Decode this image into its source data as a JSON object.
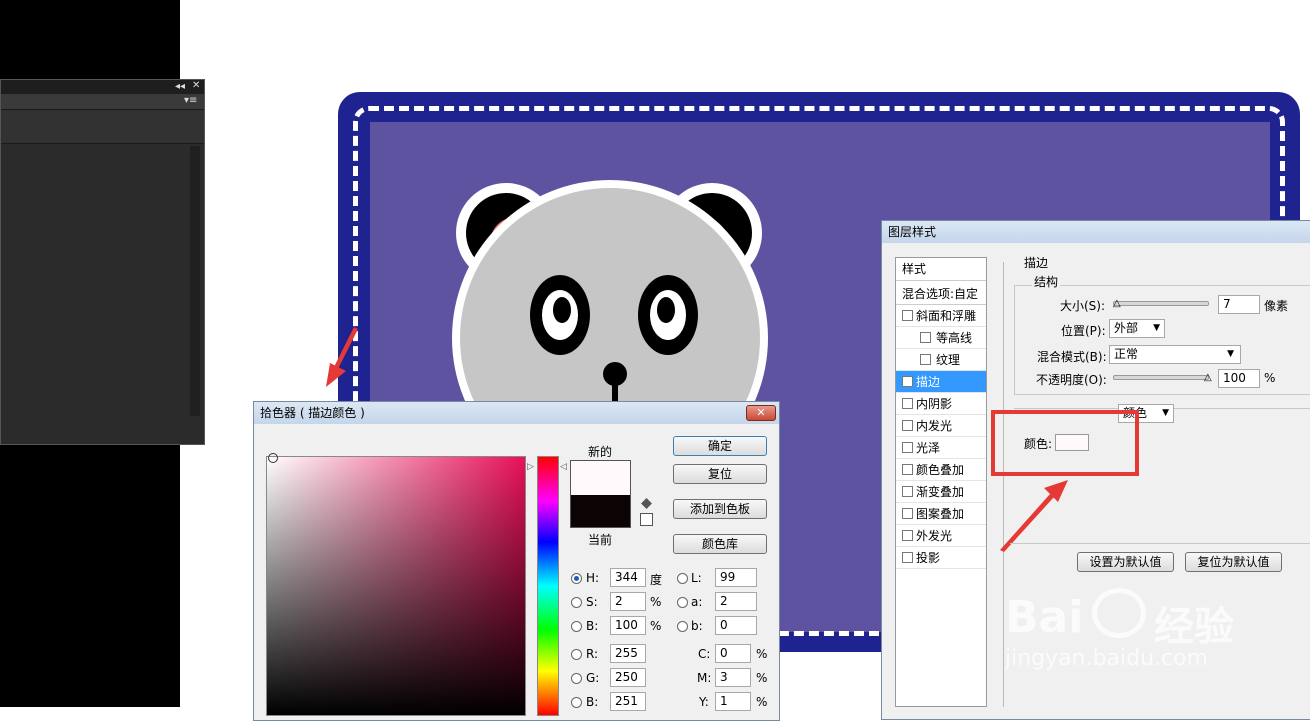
{
  "picker": {
    "title": "拾色器 ( 描边颜色 )",
    "new_label": "新的",
    "current_label": "当前",
    "buttons": {
      "ok": "确定",
      "reset": "复位",
      "add_swatch": "添加到色板",
      "color_libraries": "颜色库"
    },
    "hsb": [
      {
        "label": "H:",
        "value": "344",
        "unit": "度"
      },
      {
        "label": "S:",
        "value": "2",
        "unit": "%"
      },
      {
        "label": "B:",
        "value": "100",
        "unit": "%"
      }
    ],
    "lab": [
      {
        "label": "L:",
        "value": "99"
      },
      {
        "label": "a:",
        "value": "2"
      },
      {
        "label": "b:",
        "value": "0"
      }
    ],
    "rgb": [
      {
        "label": "R:",
        "value": "255"
      },
      {
        "label": "G:",
        "value": "250"
      },
      {
        "label": "B:",
        "value": "251"
      }
    ],
    "cmyk": [
      {
        "label": "C:",
        "value": "0",
        "unit": "%"
      },
      {
        "label": "M:",
        "value": "3",
        "unit": "%"
      },
      {
        "label": "Y:",
        "value": "1",
        "unit": "%"
      }
    ],
    "new_color": "#fff9fb",
    "current_color": "#0c0404"
  },
  "layer_style": {
    "title": "图层样式",
    "styles_header": "样式",
    "blend_options": "混合选项:自定",
    "items": [
      {
        "label": "斜面和浮雕",
        "checked": false,
        "indent": false
      },
      {
        "label": "等高线",
        "checked": false,
        "indent": true
      },
      {
        "label": "纹理",
        "checked": false,
        "indent": true
      },
      {
        "label": "描边",
        "checked": true,
        "indent": false,
        "selected": true
      },
      {
        "label": "内阴影",
        "checked": false,
        "indent": false
      },
      {
        "label": "内发光",
        "checked": false,
        "indent": false
      },
      {
        "label": "光泽",
        "checked": false,
        "indent": false
      },
      {
        "label": "颜色叠加",
        "checked": false,
        "indent": false
      },
      {
        "label": "渐变叠加",
        "checked": false,
        "indent": false
      },
      {
        "label": "图案叠加",
        "checked": false,
        "indent": false
      },
      {
        "label": "外发光",
        "checked": false,
        "indent": false
      },
      {
        "label": "投影",
        "checked": false,
        "indent": false
      }
    ],
    "stroke_group": "描边",
    "structure_group": "结构",
    "size_label": "大小(S):",
    "size_value": "7",
    "size_unit": "像素",
    "position_label": "位置(P):",
    "position_value": "外部",
    "blend_mode_label": "混合模式(B):",
    "blend_mode_value": "正常",
    "opacity_label": "不透明度(O):",
    "opacity_value": "100",
    "opacity_unit": "%",
    "fill_type_value": "颜色",
    "color_label": "颜色:",
    "set_default": "设置为默认值",
    "reset_default": "复位为默认值"
  },
  "watermark": {
    "brand": "Bai",
    "brand_cn": "经验",
    "url": "jingyan.baidu.com"
  },
  "colors": {
    "highlight": "#e53935",
    "canvas_border": "#1f2390",
    "canvas_fill": "#5e53a0"
  }
}
